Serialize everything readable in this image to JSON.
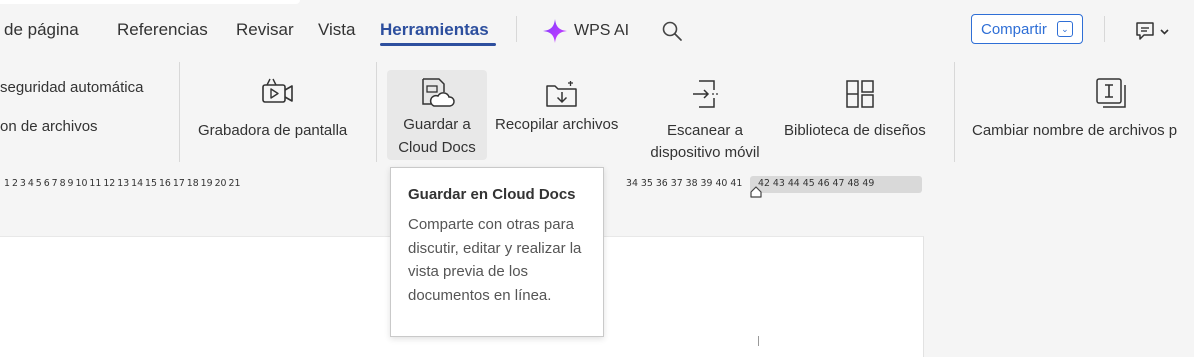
{
  "menu": {
    "items": [
      {
        "label": "de página"
      },
      {
        "label": "Referencias"
      },
      {
        "label": "Revisar"
      },
      {
        "label": "Vista"
      },
      {
        "label": "Herramientas"
      }
    ],
    "wps_ai_label": "WPS AI",
    "share_label": "Compartir",
    "accent_color": "#2d4f9e"
  },
  "ribbon": {
    "backup_label_1": "seguridad automática",
    "backup_label_2": "on de archivos",
    "screen_recorder_label": "Grabadora de pantalla",
    "save_cloud_line1": "Guardar a",
    "save_cloud_line2": "Cloud Docs",
    "collect_files_label": "Recopilar archivos",
    "scan_line1": "Escanear a",
    "scan_line2": "dispositivo móvil",
    "design_library_label": "Biblioteca de diseños",
    "rename_files_label": "Cambiar nombre de archivos p"
  },
  "ruler": {
    "left_numbers": "1  2  3  4  5  6  7  8  9  10 11 12 13 14 15 16 17 18 19 20 21",
    "mid_numbers": "34 35 36 37 38 39 40 41",
    "right_numbers": "42 43 44 45 46 47 48 49"
  },
  "tooltip": {
    "title": "Guardar en Cloud Docs",
    "body": "Comparte con otras para discutir, editar y realizar la vista previa de los documentos en línea."
  },
  "icons": [
    "sparkle-icon",
    "search-icon",
    "comment-icon",
    "screen-record-icon",
    "cloud-save-icon",
    "collect-files-icon",
    "scan-to-mobile-icon",
    "design-library-icon",
    "rename-files-icon"
  ]
}
